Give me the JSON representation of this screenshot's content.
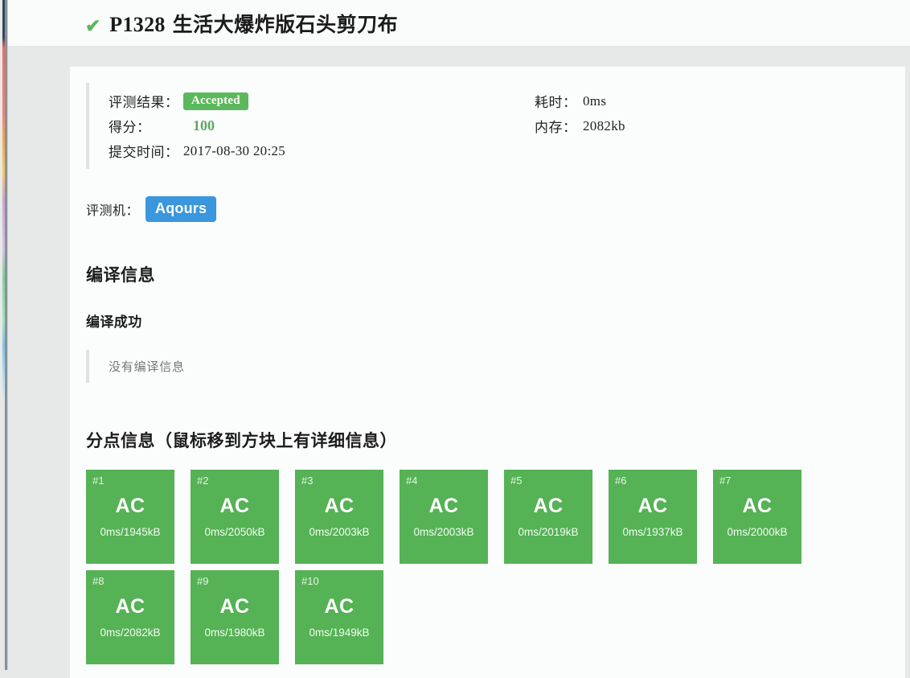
{
  "header": {
    "status_icon": "check-icon",
    "check_glyph": "✔",
    "problem_id": "P1328",
    "problem_title": "生活大爆炸版石头剪刀布"
  },
  "summary": {
    "result_label": "评测结果：",
    "result_value": "Accepted",
    "score_label": "得分：",
    "score_value": "100",
    "submit_time_label": "提交时间：",
    "submit_time_value": "2017-08-30 20:25",
    "time_label": "耗时：",
    "time_value": "0ms",
    "memory_label": "内存：",
    "memory_value": "2082kb"
  },
  "judger": {
    "label": "评测机：",
    "name": "Aqours"
  },
  "compile": {
    "heading": "编译信息",
    "sub_heading": "编译成功",
    "message": "没有编译信息"
  },
  "subtask": {
    "heading": "分点信息（鼠标移到方块上有详细信息）",
    "cases": [
      {
        "id": "#1",
        "status": "AC",
        "detail": "0ms/1945kB"
      },
      {
        "id": "#2",
        "status": "AC",
        "detail": "0ms/2050kB"
      },
      {
        "id": "#3",
        "status": "AC",
        "detail": "0ms/2003kB"
      },
      {
        "id": "#4",
        "status": "AC",
        "detail": "0ms/2003kB"
      },
      {
        "id": "#5",
        "status": "AC",
        "detail": "0ms/2019kB"
      },
      {
        "id": "#6",
        "status": "AC",
        "detail": "0ms/1937kB"
      },
      {
        "id": "#7",
        "status": "AC",
        "detail": "0ms/2000kB"
      },
      {
        "id": "#8",
        "status": "AC",
        "detail": "0ms/2082kB"
      },
      {
        "id": "#9",
        "status": "AC",
        "detail": "0ms/1980kB"
      },
      {
        "id": "#10",
        "status": "AC",
        "detail": "0ms/1949kB"
      }
    ]
  },
  "colors": {
    "accepted_green": "#5cb85c",
    "case_green": "#55b255",
    "judger_blue": "#3a96dd",
    "score_green": "#5eaa5e",
    "page_background": "#e7e9e8",
    "card_background": "#fbfcfc"
  }
}
